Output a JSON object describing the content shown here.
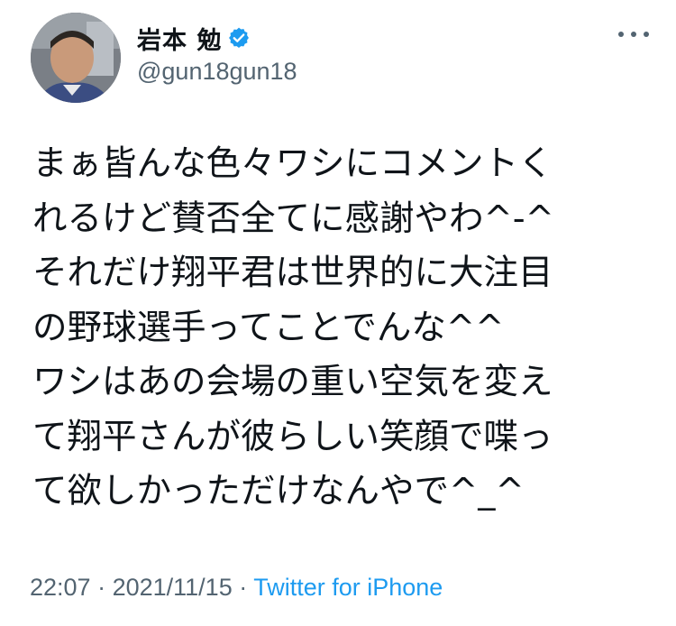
{
  "author": {
    "display_name": "岩本 勉",
    "handle": "@gun18gun18",
    "verified_icon": "verified-badge-icon",
    "avatar_icon": "profile-photo"
  },
  "tweet": {
    "lines": [
      "まぁ皆んな色々ワシにコメントく",
      "れるけど賛否全てに感謝やわ^-^",
      "それだけ翔平君は世界的に大注目",
      "の野球選手ってことでんな^^",
      "ワシはあの会場の重い空気を変え",
      "て翔平さんが彼らしい笑顔で喋っ",
      "て欲しかっただけなんやで^_^"
    ]
  },
  "meta": {
    "time": "22:07",
    "separator1": " · ",
    "date": "2021/11/15",
    "separator2": " · ",
    "source": "Twitter for iPhone"
  },
  "more_icon": "more-options-icon",
  "colors": {
    "text": "#0f1419",
    "secondary": "#536471",
    "accent": "#1d9bf0"
  }
}
